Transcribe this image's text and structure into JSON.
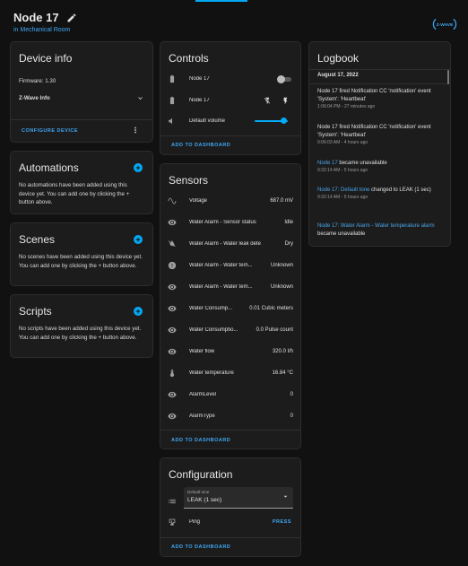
{
  "header": {
    "title": "Node 17",
    "area": "in Mechanical Room",
    "logo_text": "Z-WAVE"
  },
  "device_info": {
    "title": "Device info",
    "firmware": "Firmware: 1.30",
    "zwave_info": "Z-Wave Info",
    "configure": "CONFIGURE DEVICE"
  },
  "automations": {
    "title": "Automations",
    "text": "No automations have been added using this device yet. You can add one by clicking the + button above."
  },
  "scenes": {
    "title": "Scenes",
    "text": "No scenes have been added using this device yet. You can add one by clicking the + button above."
  },
  "scripts": {
    "title": "Scripts",
    "text": "No scripts have been added using this device yet. You can add one by clicking the + button above."
  },
  "controls": {
    "title": "Controls",
    "rows": [
      {
        "label": "Node 17",
        "icon": "battery-icon"
      },
      {
        "label": "Node 17",
        "icon": "battery-icon"
      },
      {
        "label": "Default volume",
        "icon": "volume-icon",
        "volume_fraction": 0.95
      }
    ],
    "add": "ADD TO DASHBOARD"
  },
  "sensors": {
    "title": "Sensors",
    "rows": [
      {
        "label": "Voltage",
        "value": "687.0 mV",
        "icon": "sine-wave-icon"
      },
      {
        "label": "Water Alarm - Sensor status",
        "value": "Idle",
        "icon": "eye-icon"
      },
      {
        "label": "Water Alarm - Water leak detec...",
        "value": "Dry",
        "icon": "water-off-icon"
      },
      {
        "label": "Water Alarm - Water tem...",
        "value": "Unknown",
        "icon": "alert-circle-icon"
      },
      {
        "label": "Water Alarm - Water tem...",
        "value": "Unknown",
        "icon": "eye-icon"
      },
      {
        "label": "Water Consump...",
        "value": "0.01 Cubic meters",
        "icon": "eye-icon"
      },
      {
        "label": "Water Consumptio...",
        "value": "0.0 Pulse count",
        "icon": "eye-icon"
      },
      {
        "label": "Water flow",
        "value": "320.0 l/h",
        "icon": "eye-icon"
      },
      {
        "label": "Water temperature",
        "value": "16.84 °C",
        "icon": "thermometer-icon"
      },
      {
        "label": "AlarmLevel",
        "value": "0",
        "icon": "eye-icon"
      },
      {
        "label": "AlarmType",
        "value": "0",
        "icon": "eye-icon"
      }
    ],
    "add": "ADD TO DASHBOARD"
  },
  "configuration": {
    "title": "Configuration",
    "select_label": "Default tone",
    "select_value": "LEAK (1 sec)",
    "ping_label": "Ping",
    "ping_action": "PRESS",
    "add": "ADD TO DASHBOARD"
  },
  "logbook": {
    "title": "Logbook",
    "date": "August 17, 2022",
    "entries": [
      {
        "pre": "",
        "entity": "",
        "text": "Node 17 fired Notification CC 'notification' event 'System': 'Heartbeat'",
        "time": "1:06:04 PM - 27 minutes ago"
      },
      {
        "pre": "",
        "entity": "",
        "text": "Node 17 fired Notification CC 'notification' event 'System': 'Heartbeat'",
        "time": "9:06:03 AM - 4 hours ago"
      },
      {
        "pre": "",
        "entity": "Node 17",
        "text": " became unavailable",
        "time": "9:32:14 AM - 5 hours ago"
      },
      {
        "pre": "",
        "entity": "Node 17: Default tone",
        "text": " changed to LEAK (1 sec)",
        "time": "9:32:14 AM - 5 hours ago"
      },
      {
        "pre": "",
        "entity": "Node 17: Water Alarm - Water temperature alarm",
        "text": " became unavailable",
        "time": ""
      }
    ]
  },
  "colors": {
    "accent": "#03a9f4",
    "link": "#3fa7f5",
    "background": "#111111",
    "card": "#1c1c1c"
  }
}
